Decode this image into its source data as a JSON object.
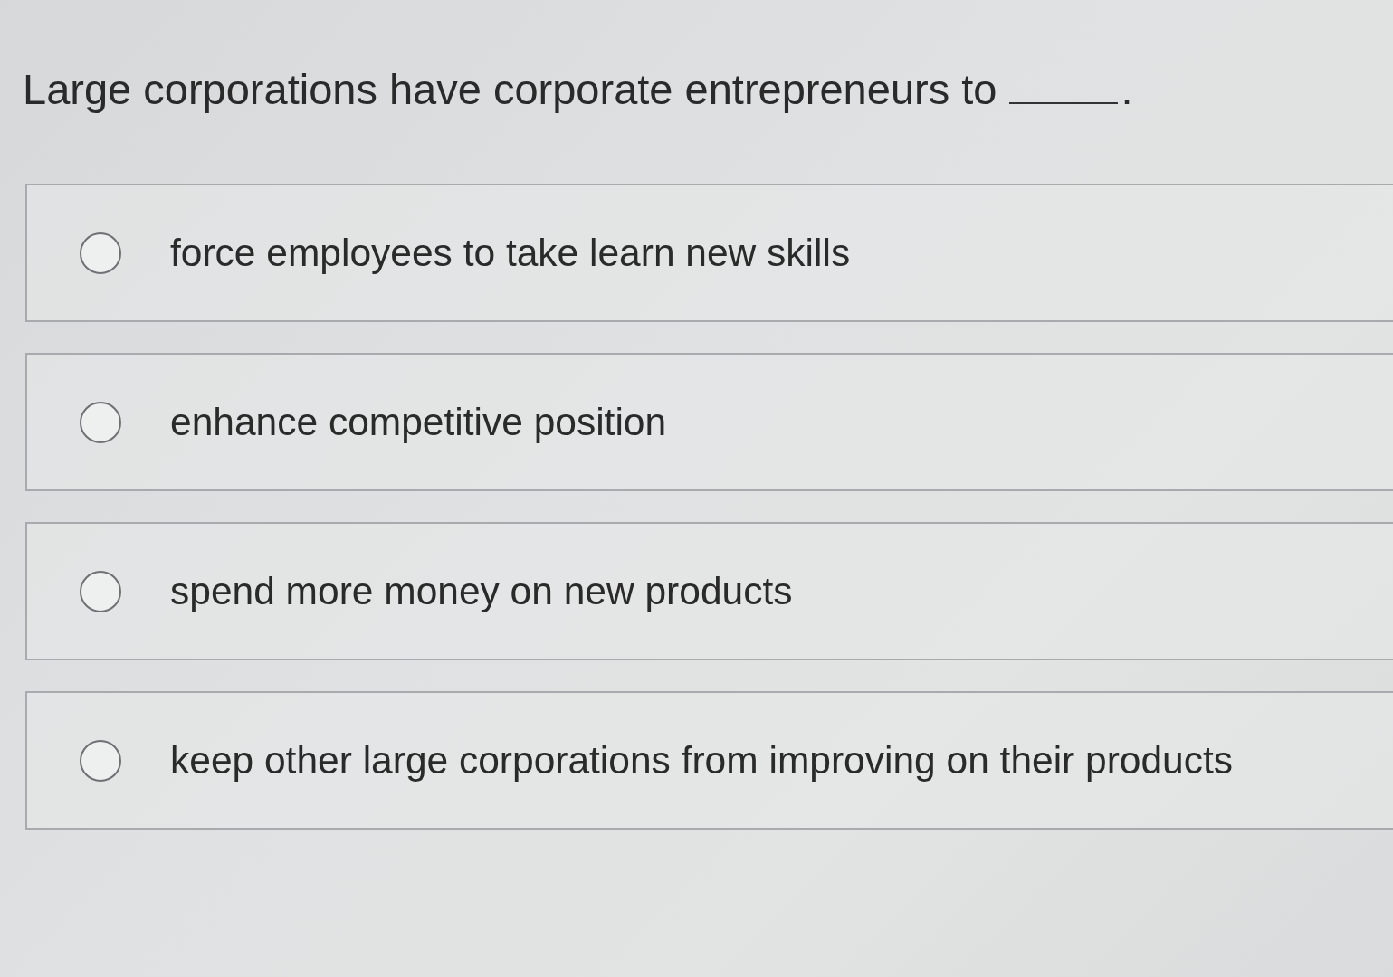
{
  "question": {
    "text": "Large corporations have corporate entrepreneurs to",
    "end": "."
  },
  "options": [
    {
      "label": "force employees to take learn new skills",
      "selected": false
    },
    {
      "label": "enhance competitive position",
      "selected": false
    },
    {
      "label": "spend more money on new products",
      "selected": false
    },
    {
      "label": "keep other large corporations from improving on their products",
      "selected": false
    }
  ]
}
